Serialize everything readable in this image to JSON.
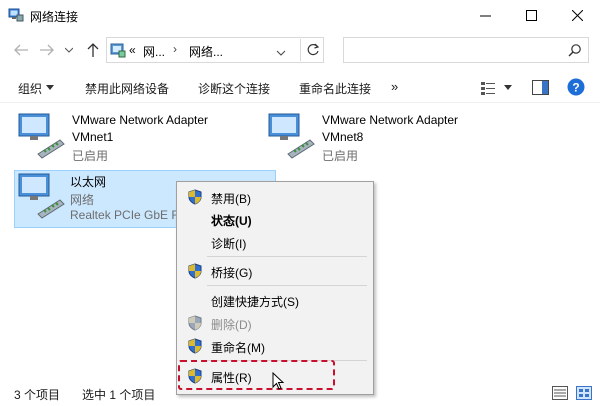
{
  "window": {
    "title": "网络连接"
  },
  "nav": {
    "breadcrumb_prefix": "«",
    "crumbs": [
      "网...",
      "网络..."
    ],
    "search_placeholder": ""
  },
  "toolbar": {
    "organize": "组织",
    "disable": "禁用此网络设备",
    "diagnose": "诊断这个连接",
    "rename": "重命名此连接",
    "more": "»"
  },
  "items": [
    {
      "name": "VMware Network Adapter",
      "name2": "VMnet1",
      "status": "已启用"
    },
    {
      "name": "VMware Network Adapter",
      "name2": "VMnet8",
      "status": "已启用"
    },
    {
      "name": "以太网",
      "name2": "网络",
      "status": "Realtek PCIe GbE F"
    }
  ],
  "context_menu": {
    "disable": "禁用(B)",
    "status": "状态(U)",
    "diagnose": "诊断(I)",
    "bridge": "桥接(G)",
    "create_shortcut": "创建快捷方式(S)",
    "delete": "删除(D)",
    "rename": "重命名(M)",
    "properties": "属性(R)"
  },
  "status": {
    "count": "3 个项目",
    "selected": "选中 1 个项目"
  },
  "colors": {
    "selection": "#cce8ff",
    "highlight_dashed": "#c8102e",
    "help": "#1e6ed8"
  }
}
